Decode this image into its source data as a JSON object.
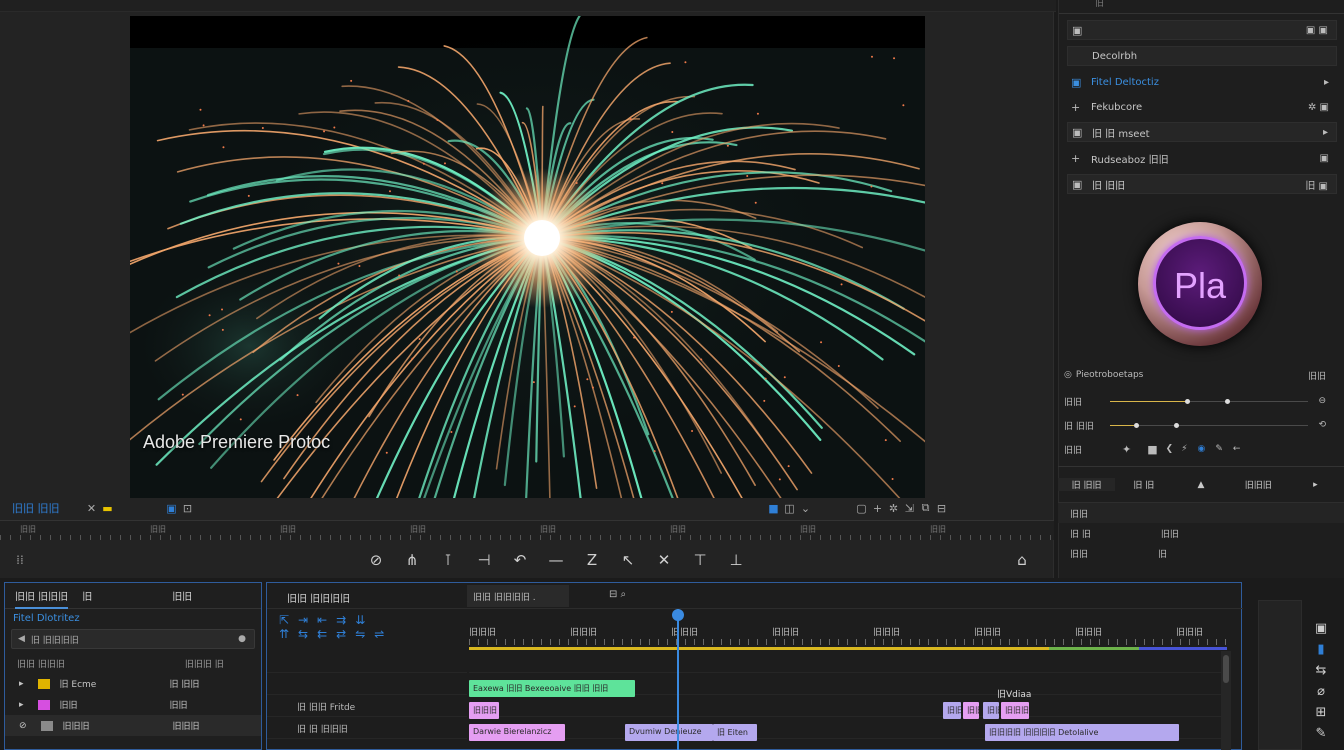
{
  "colors": {
    "accent": "#2f7fd6",
    "panel_border": "#2f5c9c",
    "green_clip": "#5ee39a",
    "pink_clip": "#e59ef2",
    "purple_clip": "#b4a8ee"
  },
  "video": {
    "watermark": "Adobe Premiere Protoc"
  },
  "monitor": {
    "left_label": "旧旧 旧旧",
    "ruler_labels": [
      "旧旧",
      "旧旧",
      "旧旧",
      "旧旧",
      "旧旧",
      "旧旧",
      "旧旧",
      "旧旧",
      "旧旧"
    ],
    "transport_icons": [
      "export-frame-icon",
      "mark-in-icon",
      "mark-out-icon",
      "go-to-in-icon",
      "step-back-icon",
      "play-stop-icon",
      "step-forward-icon",
      "go-to-out-icon",
      "insert-icon",
      "overwrite-icon",
      "lift-icon"
    ]
  },
  "right_panel": {
    "tab": "旧",
    "rows": [
      {
        "label": "Decolrbh",
        "end": ""
      },
      {
        "label": "Fitel Deltoctiz",
        "end": "▸"
      },
      {
        "label": "Fekubcore",
        "end": "✲ ▣"
      },
      {
        "label": "旧 旧 mseet",
        "end": "▸"
      },
      {
        "label": "Rudseaboz 旧旧",
        "end": "▣"
      },
      {
        "label": "旧 旧旧",
        "end": "旧 ▣"
      }
    ],
    "logo_text": "Pla",
    "lumetri_label": "Pieotroboetaps",
    "sliders": [
      {
        "label": "旧旧",
        "value": 0.38
      },
      {
        "label": "旧 旧旧",
        "value": 0.12
      }
    ],
    "bottom_row_label": "旧旧",
    "tabs": [
      "旧 旧旧",
      "旧 旧",
      "▲",
      "旧旧旧",
      "▸"
    ],
    "meta_rows": [
      {
        "k": "旧旧",
        "v": ""
      },
      {
        "k": "旧 旧",
        "v": "旧旧"
      },
      {
        "k": "旧旧",
        "v": "旧"
      }
    ]
  },
  "project": {
    "tabs": [
      "旧旧 旧旧旧",
      "旧",
      "旧旧"
    ],
    "selected_bin": "Fitel Dlotritez",
    "search_text": "旧 旧旧旧旧",
    "header": [
      "旧旧 旧旧旧",
      "旧旧旧 旧"
    ],
    "items": [
      {
        "name": "旧 Ecme",
        "swatch": "#e0b400",
        "tag": "旧 旧旧"
      },
      {
        "name": "旧旧",
        "swatch": "#d64fe0",
        "tag": "旧旧"
      },
      {
        "name": "旧旧旧",
        "swatch": "#8a8a8a",
        "tag": "旧旧旧"
      }
    ]
  },
  "timeline": {
    "title": "旧旧 旧旧旧旧",
    "sequence": "旧旧 旧旧旧旧 .",
    "ruler_labels": [
      "旧旧旧",
      "旧旧旧",
      "旧旧旧",
      "旧旧旧",
      "旧旧旧",
      "旧旧旧",
      "旧旧旧",
      "旧旧旧"
    ],
    "track_labels": [
      "",
      "",
      "旧 旧旧 Fritde",
      "旧 旧 旧旧旧"
    ],
    "video_label": "旧Vdiaa",
    "clips": [
      {
        "label": "Eaxewa 旧旧 Bexeeoaive 旧旧 旧旧",
        "kind": "green"
      },
      {
        "label": "旧旧旧",
        "kind": "pink"
      },
      {
        "label": "Darwie Bierelanzicz",
        "kind": "pink"
      },
      {
        "label": "Dvumiw Denieuze",
        "kind": "purple"
      },
      {
        "label": "旧 Eiten",
        "kind": "purple"
      },
      {
        "label": "旧旧",
        "kind": "purple"
      },
      {
        "label": "旧旧",
        "kind": "pink"
      },
      {
        "label": "旧旧",
        "kind": "purple"
      },
      {
        "label": "旧旧旧",
        "kind": "pink"
      },
      {
        "label": "旧旧旧旧 旧旧旧旧 Detolalive",
        "kind": "purple"
      }
    ]
  }
}
